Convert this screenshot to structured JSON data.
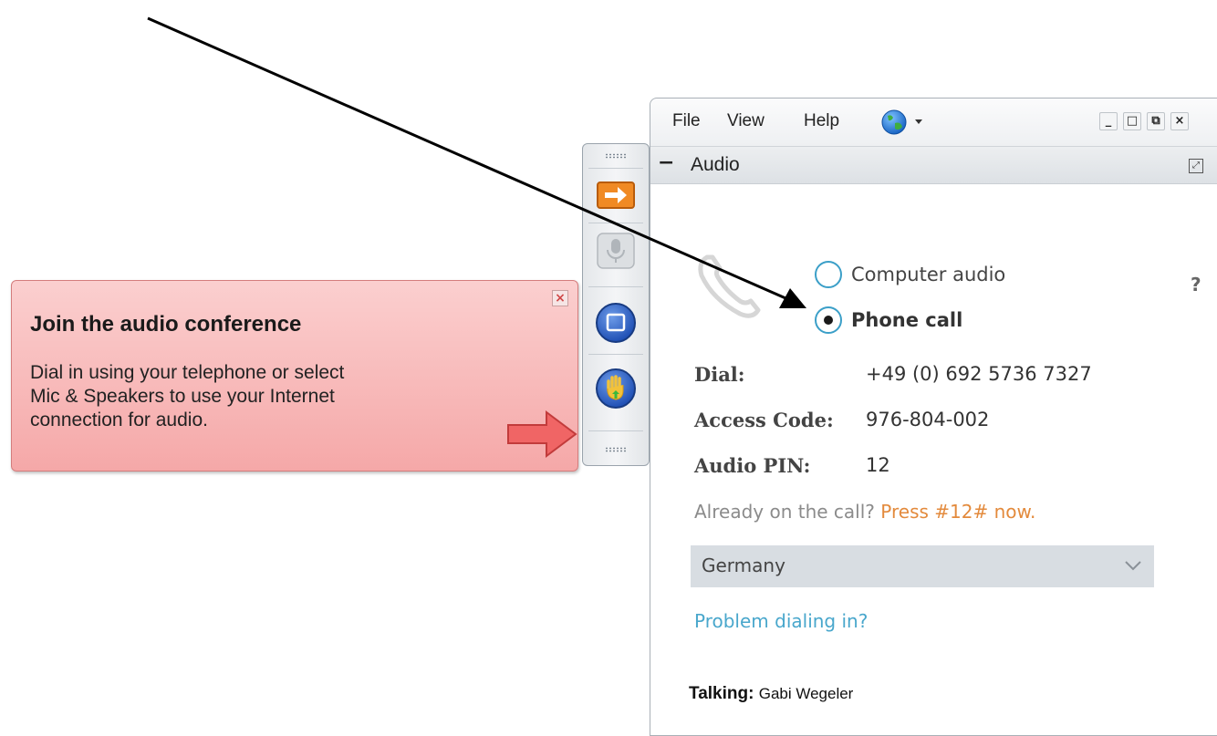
{
  "tooltip": {
    "title": "Join the audio conference",
    "body_lines": [
      "Dial in using your telephone or select",
      "Mic & Speakers to use your Internet",
      "connection for audio."
    ],
    "close": "×"
  },
  "toolbar": {
    "buttons": [
      {
        "name": "join-audio",
        "icon": "orange-arrow-icon",
        "state": "active"
      },
      {
        "name": "microphone",
        "icon": "microphone-icon",
        "state": "disabled"
      },
      {
        "name": "screen",
        "icon": "screen-share-icon",
        "state": "normal"
      },
      {
        "name": "raise-hand",
        "icon": "raise-hand-icon",
        "state": "normal"
      }
    ]
  },
  "menu": {
    "items": [
      "File",
      "View",
      "Help"
    ],
    "globe": "globe-icon"
  },
  "window_controls": [
    "_",
    "□",
    "⧉",
    "×"
  ],
  "panel": {
    "collapse": "−",
    "title": "Audio",
    "help": "?"
  },
  "audio": {
    "options": [
      {
        "label": "Computer audio",
        "selected": false
      },
      {
        "label": "Phone call",
        "selected": true
      }
    ],
    "dial_label": "Dial:",
    "dial_value": "+49 (0) 692 5736 7327",
    "access_label": "Access Code:",
    "access_value": "976-804-002",
    "pin_label": "Audio PIN:",
    "pin_value": "12",
    "already_text": "Already on the call?",
    "already_action": "Press #12# now.",
    "country": "Germany",
    "problem_link": "Problem dialing in?",
    "talking_label": "Talking:",
    "talking_name": "Gabi Wegeler"
  },
  "colors": {
    "callout_bg": "#f5a8a8",
    "link": "#49a7cc",
    "highlight": "#e38a3c",
    "radio": "#3b9fc8"
  }
}
